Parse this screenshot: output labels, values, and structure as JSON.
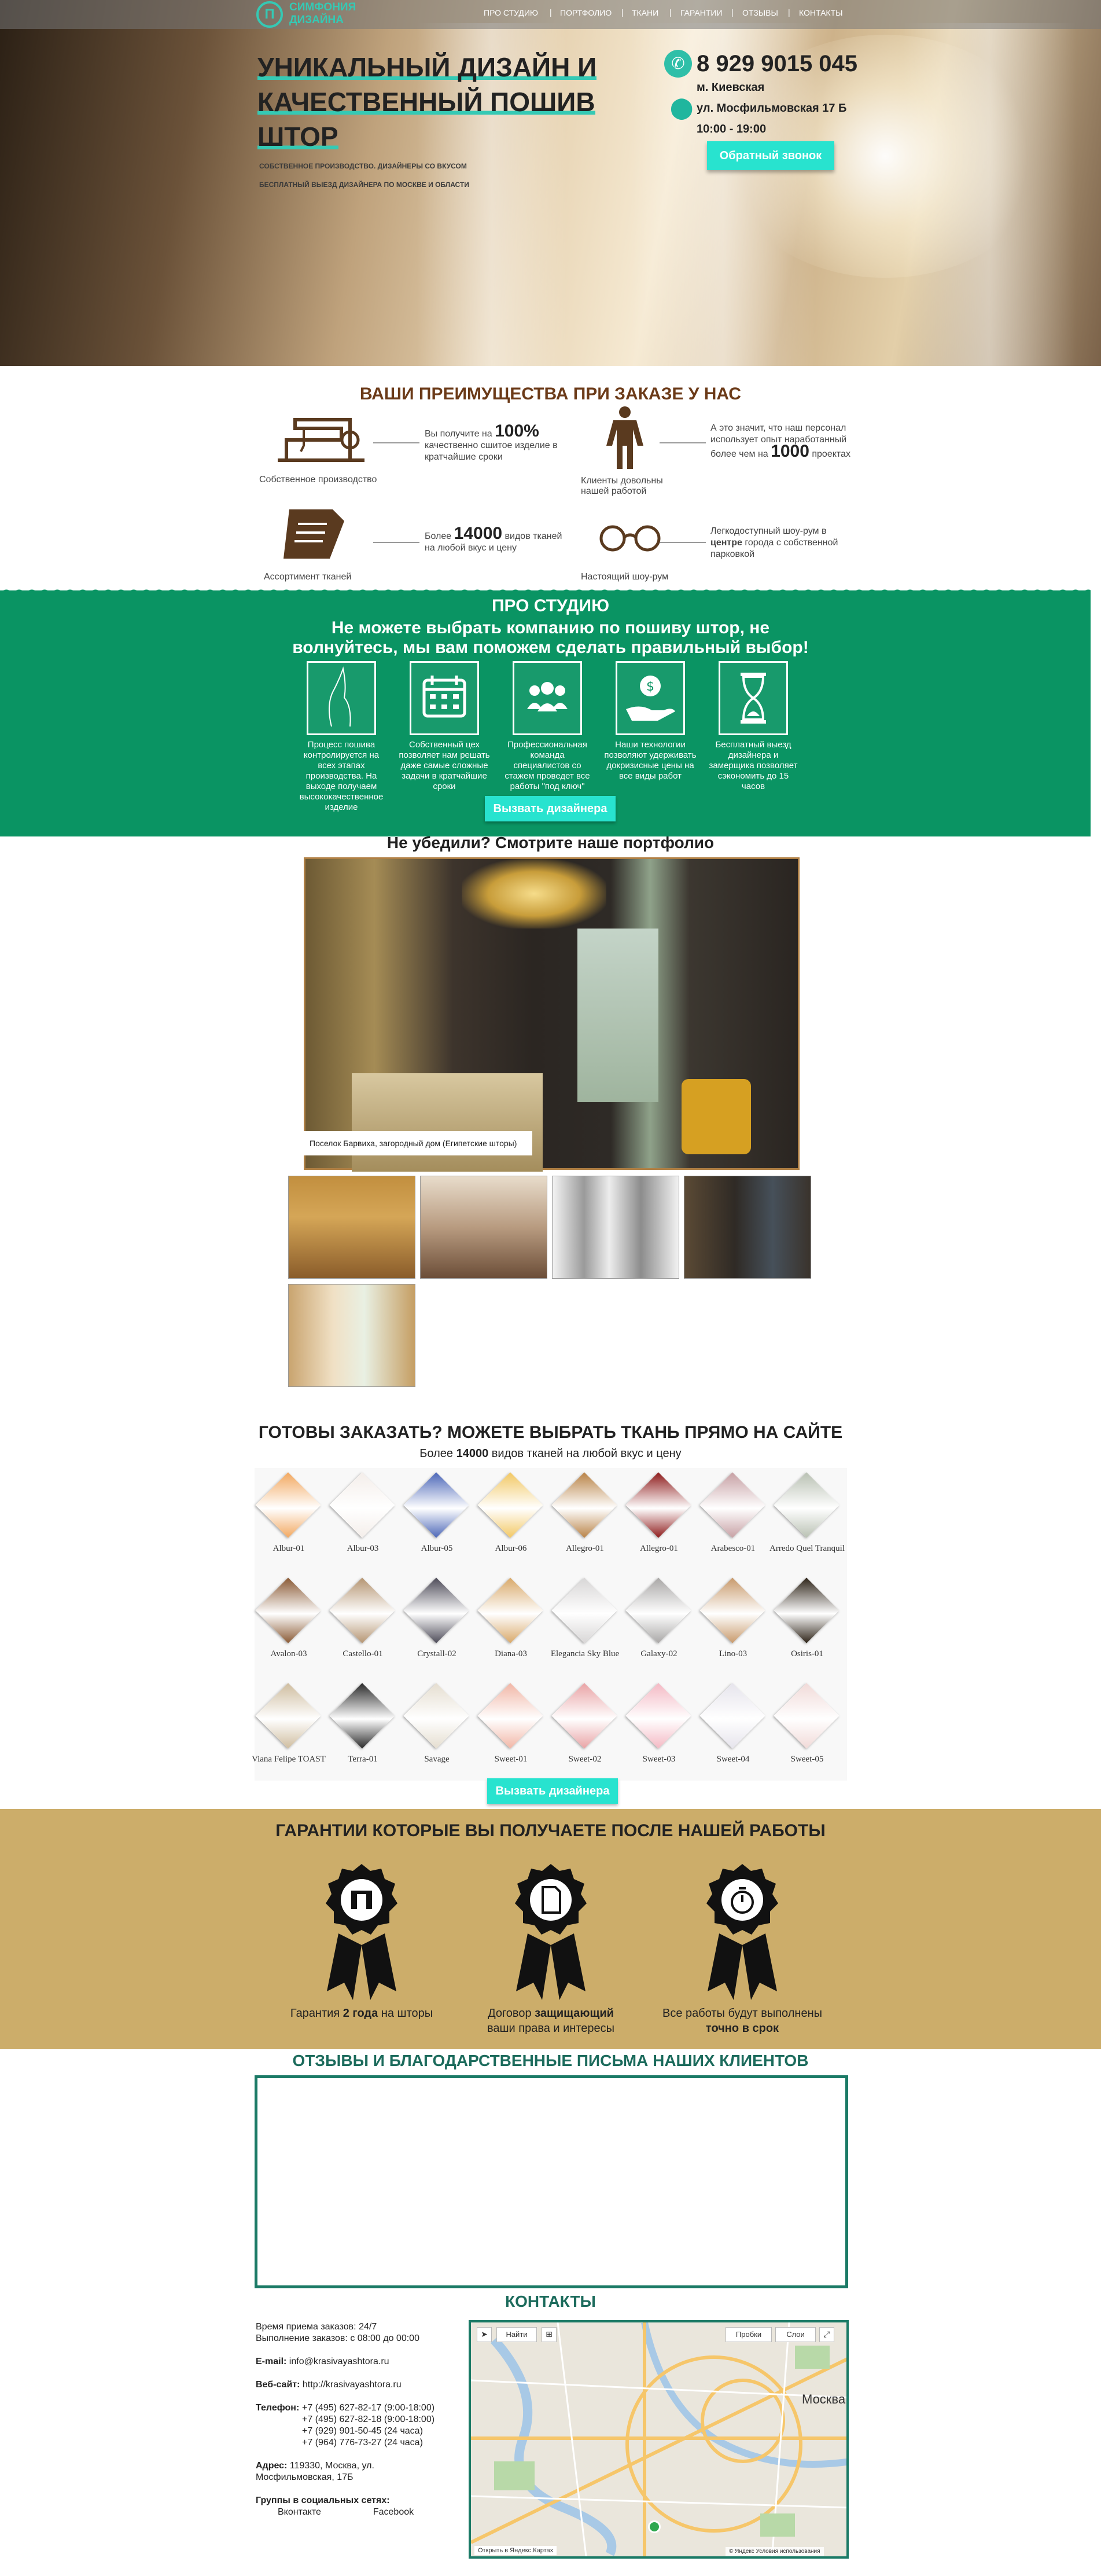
{
  "nav": {
    "logo_line1": "Симфония",
    "logo_line2": "дизайна",
    "items": [
      "ПРО СТУДИЮ",
      "ПОРТФОЛИО",
      "ТКАНИ",
      "ГАРАНТИИ",
      "ОТЗЫВЫ",
      "КОНТАКТЫ"
    ]
  },
  "hero": {
    "title_lines": [
      "УНИКАЛЬНЫЙ ДИЗАЙН И",
      "КАЧЕСТВЕННЫЙ ПОШИВ",
      "ШТОР"
    ],
    "sub1": "СОБСТВЕННОЕ ПРОИЗВОДСТВО. ДИЗАЙНЕРЫ СО ВКУСОМ",
    "sub2": "БЕСПЛАТНЫЙ ВЫЕЗД ДИЗАЙНЕРА ПО МОСКВЕ И ОБЛАСТИ",
    "phone": "8 929 9015 045",
    "metro": "м. Киевская",
    "address": "ул. Мосфильмовская 17 Б",
    "hours": "10:00 - 19:00",
    "callback": "Обратный звонок"
  },
  "advantages": {
    "title": "ВАШИ ПРЕИМУЩЕСТВА ПРИ ЗАКАЗЕ У НАС",
    "items": [
      {
        "caption": "Собственное производство",
        "t1": "Вы получите на",
        "big": "100%",
        "t2": "качественно сшитое изделие в кратчайшие сроки"
      },
      {
        "caption": "Клиенты довольны нашей работой",
        "t1": "А это значит, что наш персонал использует опыт наработанный более чем на",
        "big": "1000",
        "t2": "проектах"
      },
      {
        "caption": "Ассортимент тканей",
        "t1": "Более",
        "big": "14000",
        "t2": "видов тканей на любой вкус и цену"
      },
      {
        "caption": "Настоящий шоу-рум",
        "t1": "Легкодоступный шоу-рум в",
        "bold": "центре",
        "t2": "города с собственной парковкой"
      }
    ]
  },
  "about": {
    "title": "ПРО СТУДИЮ",
    "subtitle1": "Не можете выбрать компанию по пошиву штор, не",
    "subtitle2": "волнуйтесь, мы вам поможем сделать правильный выбор!",
    "items": [
      {
        "icon": "hand-icon",
        "text": "Процесс пошива контролируется на всех этапах производства. На выходе получаем высококачественное изделие"
      },
      {
        "icon": "calendar-icon",
        "text": "Собственный цех позволяет нам решать даже самые сложные задачи в кратчайшие сроки"
      },
      {
        "icon": "team-icon",
        "text": "Профессиональная команда специалистов со стажем проведет все работы \"под ключ\""
      },
      {
        "icon": "money-hand-icon",
        "text": "Наши технологии позволяют удерживать докризисные цены на все виды работ"
      },
      {
        "icon": "hourglass-icon",
        "text": "Бесплатный выезд дизайнера и замерщика позволяет сэкономить до 15 часов"
      }
    ],
    "button": "Вызвать дизайнера"
  },
  "portfolio": {
    "title": "Не убедили? Смотрите наше портфолио",
    "caption": "Поселок Барвиха, загородный дом (Египетские шторы)"
  },
  "fabrics": {
    "title": "ГОТОВЫ ЗАКАЗАТЬ? МОЖЕТЕ ВЫБРАТЬ ТКАНЬ ПРЯМО НА САЙТЕ",
    "sub_before": "Более",
    "sub_bold": "14000",
    "sub_after": "видов тканей на любой вкус и цену",
    "items": [
      {
        "name": "Albur-01",
        "color": "#f2a860"
      },
      {
        "name": "Albur-03",
        "color": "#f4eeea"
      },
      {
        "name": "Albur-05",
        "color": "#4c67b8"
      },
      {
        "name": "Albur-06",
        "color": "#f2c864"
      },
      {
        "name": "Allegro-01",
        "color": "#b98347"
      },
      {
        "name": "Allegro-01",
        "color": "#8e1c1c"
      },
      {
        "name": "Arabesco-01",
        "color": "#c7a0a4"
      },
      {
        "name": "Arredo Quel Tranquil",
        "color": "#b9c1b3"
      },
      {
        "name": "Avalon-03",
        "color": "#8a5a35"
      },
      {
        "name": "Castello-01",
        "color": "#b59572"
      },
      {
        "name": "Crystall-02",
        "color": "#4d4b58"
      },
      {
        "name": "Diana-03",
        "color": "#d9a96a"
      },
      {
        "name": "Elegancia Sky Blue",
        "color": "#d8d6d6"
      },
      {
        "name": "Galaxy-02",
        "color": "#a9a7a6"
      },
      {
        "name": "Lino-03",
        "color": "#c89a6c"
      },
      {
        "name": "Osiris-01",
        "color": "#2e2418"
      },
      {
        "name": "Viana Felipe TOAST",
        "color": "#cfbd9f"
      },
      {
        "name": "Terra-01",
        "color": "#2a2a2a"
      },
      {
        "name": "Savage",
        "color": "#e5ded0"
      },
      {
        "name": "Sweet-01",
        "color": "#f1b6a6"
      },
      {
        "name": "Sweet-02",
        "color": "#e9a3a5"
      },
      {
        "name": "Sweet-03",
        "color": "#f4b9c4"
      },
      {
        "name": "Sweet-04",
        "color": "#e6e4ec"
      },
      {
        "name": "Sweet-05",
        "color": "#f1dad8"
      }
    ],
    "button": "Вызвать дизайнера"
  },
  "guarantees": {
    "title": "ГАРАНТИИ КОТОРЫЕ ВЫ ПОЛУЧАЕТЕ ПОСЛЕ НАШЕЙ РАБОТЫ",
    "items": [
      {
        "icon": "window-award-icon",
        "t1": "Гарантия",
        "b": "2 года",
        "t2": "на шторы"
      },
      {
        "icon": "document-award-icon",
        "t1": "Договор",
        "b": "защищающий",
        "t2": "ваши права и интересы"
      },
      {
        "icon": "stopwatch-award-icon",
        "t1": "Все работы будут выполнены",
        "b": "точно в срок",
        "t2": ""
      }
    ]
  },
  "reviews": {
    "title": "ОТЗЫВЫ И БЛАГОДАРСТВЕННЫЕ ПИСЬМА НАШИХ КЛИЕНТОВ"
  },
  "contacts": {
    "title": "КОНТАКТЫ",
    "order_time": "Время приема заказов: 24/7",
    "work_time": "Выполнение заказов: с 08:00 до 00:00",
    "email_label": "E-mail:",
    "email": "info@krasivayashtora.ru",
    "web_label": "Веб-сайт:",
    "web": "http://krasivayashtora.ru",
    "phone_label": "Телефон:",
    "phones": [
      "+7 (495) 627-82-17 (9:00-18:00)",
      "+7 (495) 627-82-18 (9:00-18:00)",
      "+7 (929) 901-50-45 (24 часа)",
      "+7 (964) 776-73-27 (24 часа)"
    ],
    "address_label": "Адрес:",
    "address": "119330, Москва, ул. Мосфильмовская, 17Б",
    "social_label": "Группы в социальных сетях:",
    "social": [
      "Вконтакте",
      "Facebook"
    ],
    "map": {
      "find": "Найти",
      "traffic": "Пробки",
      "layers": "Слои",
      "city": "Москва",
      "open_link": "Открыть в Яндекс.Картах",
      "copyright": "© Яндекс  Условия использования"
    }
  }
}
